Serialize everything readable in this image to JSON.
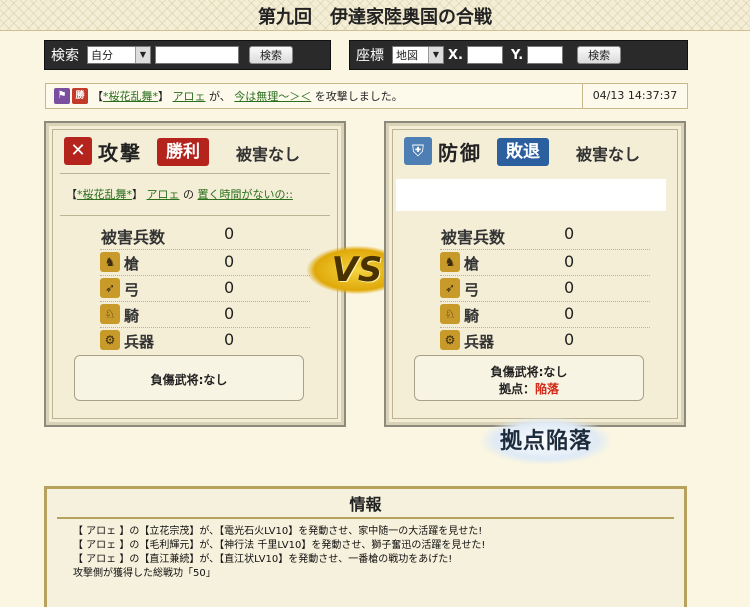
{
  "header": {
    "title": "第九回　伊達家陸奥国の合戦"
  },
  "search": {
    "label": "検索",
    "select_value": "自分",
    "input_value": "",
    "button_label": "検索"
  },
  "coords": {
    "label": "座標",
    "select_value": "地図",
    "x_label": "X.",
    "y_label": "Y.",
    "x_value": "",
    "y_value": "",
    "button_label": "検索"
  },
  "log": {
    "badge": "勝",
    "prefix": "【",
    "alliance": "*桜花乱舞*",
    "suffix": "】",
    "player": "アロェ",
    "text1": "が、",
    "target": "今は無理～＞＜",
    "text2": "を攻撃しました。",
    "timestamp": "04/13 14:37:37"
  },
  "attacker": {
    "side_label": "攻撃",
    "result": "勝利",
    "damage": "被害なし",
    "sub_prefix": "【",
    "alliance": "*桜花乱舞*",
    "sub_mid": "】",
    "player": "アロェ",
    "no": "の",
    "castle": "置く時間がないの::",
    "loss_label": "被害兵数",
    "loss_value": "0",
    "units": [
      {
        "name": "槍",
        "value": "0",
        "icon": "spear-icon"
      },
      {
        "name": "弓",
        "value": "0",
        "icon": "bow-icon"
      },
      {
        "name": "騎",
        "value": "0",
        "icon": "horse-icon"
      },
      {
        "name": "兵器",
        "value": "0",
        "icon": "siege-icon"
      }
    ],
    "injury_label": "負傷武将:なし"
  },
  "defender": {
    "side_label": "防御",
    "result": "敗退",
    "damage": "被害なし",
    "loss_label": "被害兵数",
    "loss_value": "0",
    "units": [
      {
        "name": "槍",
        "value": "0",
        "icon": "spear-icon"
      },
      {
        "name": "弓",
        "value": "0",
        "icon": "bow-icon"
      },
      {
        "name": "騎",
        "value": "0",
        "icon": "horse-icon"
      },
      {
        "name": "兵器",
        "value": "0",
        "icon": "siege-icon"
      }
    ],
    "injury_label": "負傷武将:なし",
    "base_label": "拠点：",
    "base_status": "陥落"
  },
  "vs": "VS",
  "stamp": "拠点陥落",
  "info": {
    "title": "情報",
    "lines": [
      "【 アロェ 】の【立花宗茂】が、【電光石火LV10】を発動させ、家中随一の大活躍を見せた!",
      "【 アロェ 】の【毛利輝元】が、【神行法 千里LV10】を発動させ、獅子奮迅の活躍を見せた!",
      "【 アロェ 】の【直江兼続】が、【直江状LV10】を発動させ、一番槍の戦功をあげた!",
      "攻撃側が獲得した総戦功「50」"
    ]
  },
  "colors": {
    "attack_badge": "#b5231d",
    "defense_badge": "#2b5f9e",
    "fallen": "#d22a1a",
    "link": "#2a6e1e"
  }
}
